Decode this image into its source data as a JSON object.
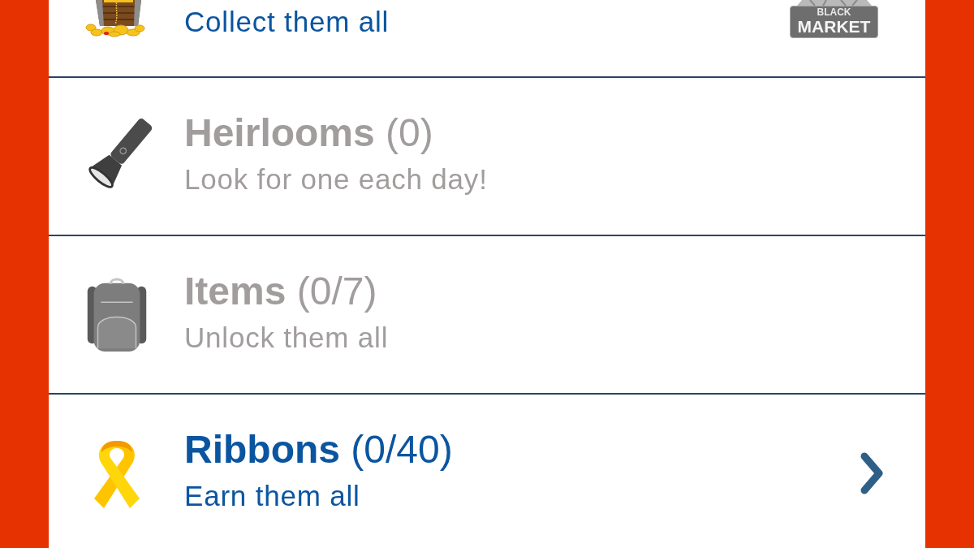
{
  "panel": {
    "rows": [
      {
        "subtitle": "Collect them all",
        "disabled": false,
        "badge": [
          "BLACK",
          "MARKET"
        ]
      },
      {
        "title": "**Heirlooms** (0)",
        "subtitle": "Look for one each day!",
        "disabled": true
      },
      {
        "title": "**Items** (0/7)",
        "subtitle": "Unlock them all",
        "disabled": true
      },
      {
        "title": "**Ribbons** (0/40)",
        "subtitle": "Earn them all",
        "disabled": false
      }
    ]
  }
}
